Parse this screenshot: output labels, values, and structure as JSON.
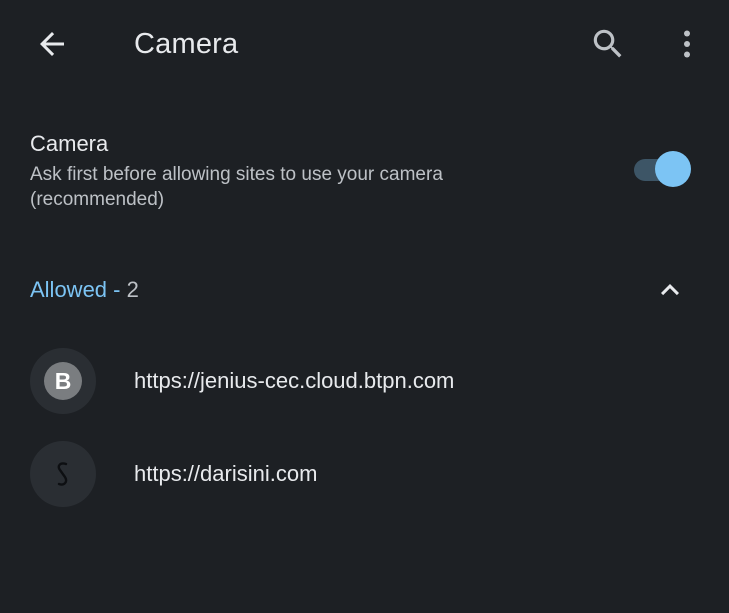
{
  "appbar": {
    "title": "Camera",
    "back_icon": "arrow-back-icon",
    "search_icon": "search-icon",
    "more_icon": "more-vert-icon"
  },
  "setting": {
    "title": "Camera",
    "description": "Ask first before allowing sites to use your camera (recommended)",
    "toggle_on": true,
    "accent_color": "#7cc4f4"
  },
  "section": {
    "label": "Allowed",
    "separator": " - ",
    "count": "2",
    "expanded_icon": "chevron-up-icon"
  },
  "sites": [
    {
      "url": "https://jenius-cec.cloud.btpn.com",
      "favicon_letter": "B"
    },
    {
      "url": "https://darisini.com",
      "favicon_icon": "darisini-logo-icon"
    }
  ]
}
